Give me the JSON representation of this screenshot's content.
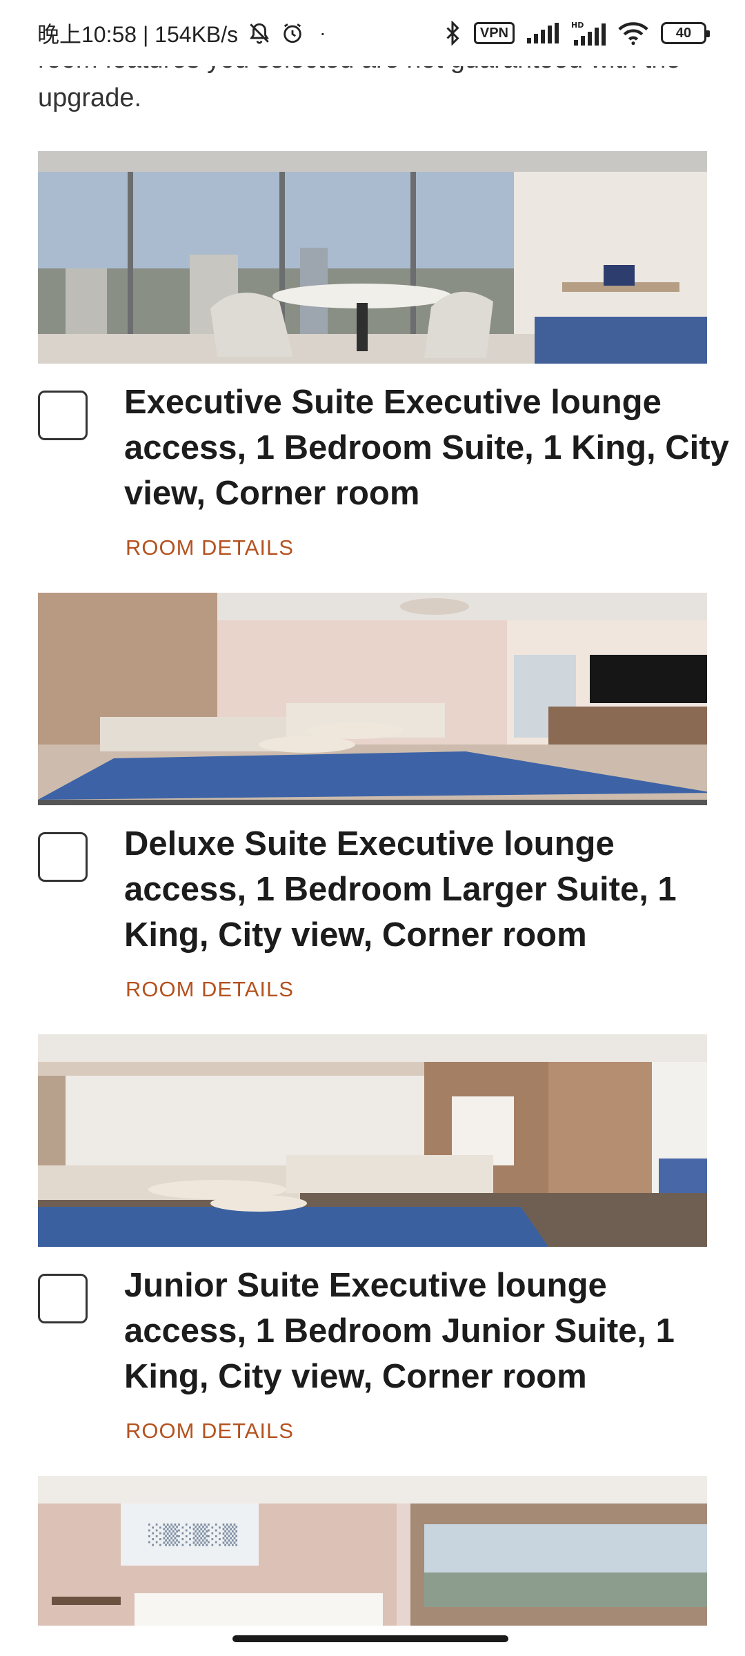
{
  "status_bar": {
    "time": "晚上10:58 | 154KB/s",
    "vpn": "VPN",
    "battery": "40",
    "dot": "·"
  },
  "intro": {
    "text": "room features you selected are not guaranteed with the upgrade."
  },
  "rooms": [
    {
      "title": "Executive Suite Executive lounge access, 1 Bedroom Suite, 1 King, City view, Corner room",
      "details_label": "ROOM DETAILS"
    },
    {
      "title": "Deluxe Suite Executive lounge access, 1 Bedroom Larger Suite, 1 King, City view, Corner room",
      "details_label": "ROOM DETAILS"
    },
    {
      "title": "Junior Suite Executive lounge access, 1 Bedroom Junior Suite, 1 King, City view, Corner room",
      "details_label": "ROOM DETAILS"
    }
  ],
  "colors": {
    "accent": "#b4521f",
    "text": "#1c1c1c"
  }
}
